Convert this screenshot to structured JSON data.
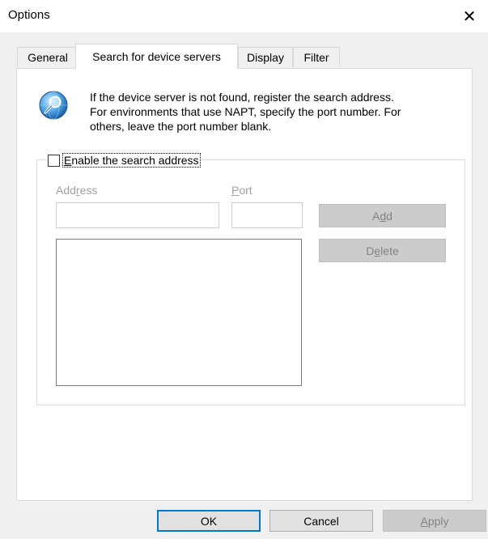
{
  "window": {
    "title": "Options",
    "close_glyph": "✕"
  },
  "tabs": [
    {
      "label": "General",
      "active": false
    },
    {
      "label": "Search for device servers",
      "active": true
    },
    {
      "label": "Display",
      "active": false
    },
    {
      "label": "Filter",
      "active": false
    }
  ],
  "info": {
    "icon": "search-globe-icon",
    "lines": [
      "If the device server is not found, register the search address.",
      "For environments that use NAPT, specify the port number. For",
      "others, leave the port number blank."
    ]
  },
  "search_group": {
    "enable_label": "Enable the search address",
    "enable_checked": false,
    "address_label": "Address",
    "address_value": "",
    "port_label": "Port",
    "port_value": "",
    "add_button": "Add",
    "delete_button": "Delete",
    "address_list": []
  },
  "footer": {
    "ok": "OK",
    "cancel": "Cancel",
    "apply": "Apply"
  },
  "colors": {
    "window_bg": "#f0f0f0",
    "panel_bg": "#ffffff",
    "default_button_border": "#0078d7",
    "disabled_text": "#a0a0a0"
  }
}
